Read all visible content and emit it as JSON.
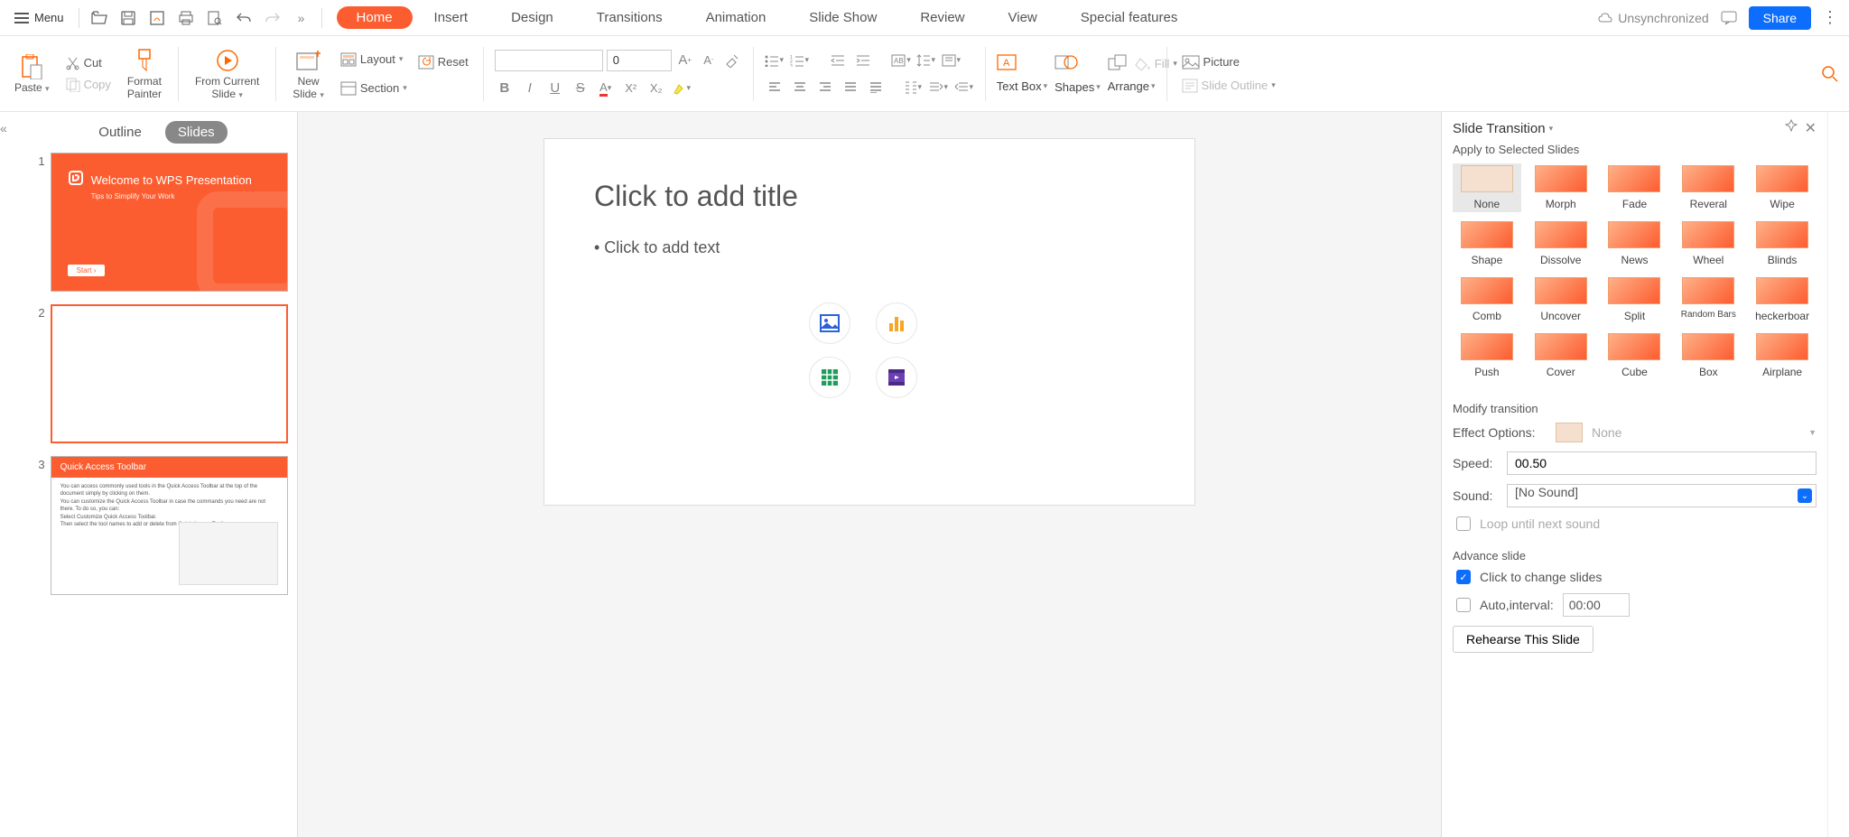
{
  "menu_label": "Menu",
  "tabs": [
    "Home",
    "Insert",
    "Design",
    "Transitions",
    "Animation",
    "Slide Show",
    "Review",
    "View",
    "Special features"
  ],
  "active_tab": "Home",
  "sync_label": "Unsynchronized",
  "share_label": "Share",
  "ribbon": {
    "paste": "Paste",
    "cut": "Cut",
    "copy": "Copy",
    "format_painter": "Format\nPainter",
    "from_current": "From Current\nSlide",
    "new_slide": "New\nSlide",
    "layout": "Layout",
    "reset": "Reset",
    "section": "Section",
    "font_size": "0",
    "text_box": "Text Box",
    "shapes": "Shapes",
    "arrange": "Arrange",
    "picture": "Picture",
    "fill": "Fill",
    "slide_outline": "Slide Outline"
  },
  "left_panel": {
    "outline": "Outline",
    "slides": "Slides",
    "thumbs": [
      {
        "n": "1",
        "title": "Welcome to WPS Presentation",
        "sub": "Tips to Simplify Your Work",
        "btn": "Start ›"
      },
      {
        "n": "2"
      },
      {
        "n": "3",
        "title": "Quick Access Toolbar",
        "body": "You can access commonly used tools in the Quick Access Toolbar at the top of the document simply by clicking on them.\nYou can customize the Quick Access Toolbar in case the commands you need are not there. To do so, you can:\nSelect Customize Quick Access Toolbar.\nThen select the tool names to add or delete from Quick Access Toolbar."
      }
    ]
  },
  "slide": {
    "title_ph": "Click to add title",
    "text_ph": "• Click to add text"
  },
  "right_panel": {
    "title": "Slide Transition",
    "apply_label": "Apply to Selected Slides",
    "transitions": [
      "None",
      "Morph",
      "Fade",
      "Reveral",
      "Wipe",
      "Shape",
      "Dissolve",
      "News",
      "Wheel",
      "Blinds",
      "Comb",
      "Uncover",
      "Split",
      "Random Bars",
      "Checkerboard",
      "Push",
      "Cover",
      "Cube",
      "Box",
      "Airplane"
    ],
    "selected_transition": "None",
    "modify_label": "Modify transition",
    "effect_label": "Effect Options:",
    "effect_value": "None",
    "speed_label": "Speed:",
    "speed_value": "00.50",
    "sound_label": "Sound:",
    "sound_value": "[No Sound]",
    "loop_label": "Loop until next sound",
    "advance_label": "Advance slide",
    "click_label": "Click to change slides",
    "auto_label": "Auto,interval:",
    "auto_value": "00:00",
    "rehearse": "Rehearse This Slide"
  }
}
